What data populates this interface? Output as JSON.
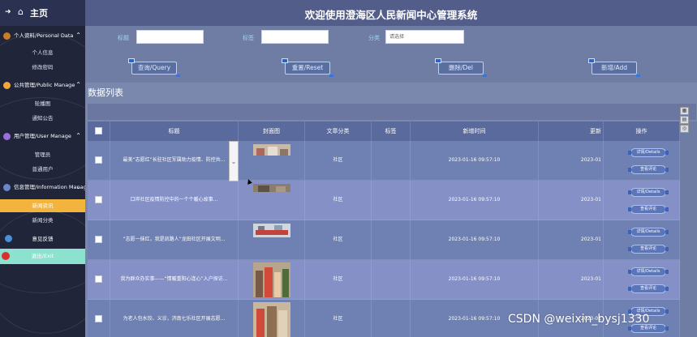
{
  "sidebar": {
    "home": "主页",
    "sections": [
      {
        "label": "个人资料/Personal Data",
        "items": [
          "个人信息",
          "修改密码"
        ],
        "color": "#c77d2a"
      },
      {
        "label": "公共管理/Public Manage",
        "items": [
          "轮播图",
          "通知公告"
        ],
        "color": "#f2a83b"
      },
      {
        "label": "用户管理/User Manage",
        "items": [
          "管理员",
          "普通用户"
        ],
        "color": "#9a6fd8"
      },
      {
        "label": "信息管理/Information Manage",
        "items": [
          "新闻资讯",
          "新闻分类"
        ],
        "color": "#6a86c9"
      }
    ],
    "extra": [
      "意见反馈",
      "退出/Exit"
    ],
    "active_item": "新闻资讯"
  },
  "header": {
    "title": "欢迎使用澄海区人民新闻中心管理系统"
  },
  "search": {
    "title_label": "标题",
    "tag_label": "标签",
    "category_label": "分类",
    "category_placeholder": "请选择"
  },
  "buttons": {
    "query": "查询/Query",
    "reset": "重置/Reset",
    "delete": "删除/Del",
    "add": "新增/Add"
  },
  "list_title": "数据列表",
  "toolbar_icons": [
    "grid-icon",
    "print-icon",
    "export-icon"
  ],
  "table": {
    "headers": [
      "标题",
      "封面图",
      "文章分类",
      "标签",
      "新增时间",
      "更新",
      "操作"
    ],
    "rows": [
      {
        "title": "最美“志愿红”长驻社区军属助力疫情、防控共...",
        "category": "社区",
        "tag": "",
        "created": "2023-01-16 09:57:10",
        "updated": "2023-01"
      },
      {
        "title": "口岸社区疫情防控中的一个个暖心故事...",
        "category": "社区",
        "tag": "",
        "created": "2023-01-16 09:57:10",
        "updated": "2023-01"
      },
      {
        "title": "“志愿一抹红，我是凯路人”龙田社区开展文明...",
        "category": "社区",
        "tag": "",
        "created": "2023-01-16 09:57:10",
        "updated": "2023-01"
      },
      {
        "title": "我为群众办实事——“情暖重阳心连心”入户探访...",
        "category": "社区",
        "tag": "",
        "created": "2023-01-16 09:57:10",
        "updated": "2023-01"
      },
      {
        "title": "为老人包水饺、义诊，济南七乐社区开展志愿...",
        "category": "社区",
        "tag": "",
        "created": "2023-01-16 09:57:10",
        "updated": "2023-01"
      }
    ],
    "actions": {
      "details": "详情/Details",
      "comments": "查看评论"
    }
  },
  "watermark": "CSDN @weixin_bysj1330",
  "colors": {
    "sidebar": "#20253a",
    "header": "#535d89",
    "content": "#7a88ad",
    "accent": "#f3b43d",
    "mint": "#8ce2cf"
  }
}
